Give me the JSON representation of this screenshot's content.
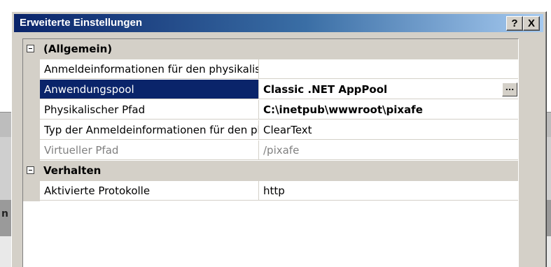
{
  "window": {
    "title": "Erweiterte Einstellungen",
    "help_label": "?",
    "close_label": "X"
  },
  "background": {
    "edge_text": "n"
  },
  "grid": {
    "categories": [
      {
        "label": "(Allgemein)",
        "properties": [
          {
            "name": "Anmeldeinformationen für den physikalischen Pfad",
            "value": ""
          },
          {
            "name": "Anwendungspool",
            "value": "Classic .NET AppPool",
            "selected": true,
            "bold": true,
            "button": "..."
          },
          {
            "name": "Physikalischer Pfad",
            "value": "C:\\inetpub\\wwwroot\\pixafe",
            "bold": true
          },
          {
            "name": "Typ der Anmeldeinformationen für den physikalischen Pfad",
            "value": "ClearText"
          },
          {
            "name": "Virtueller Pfad",
            "value": "/pixafe",
            "disabled": true
          }
        ]
      },
      {
        "label": "Verhalten",
        "properties": [
          {
            "name": "Aktivierte Protokolle",
            "value": "http"
          }
        ]
      }
    ]
  }
}
